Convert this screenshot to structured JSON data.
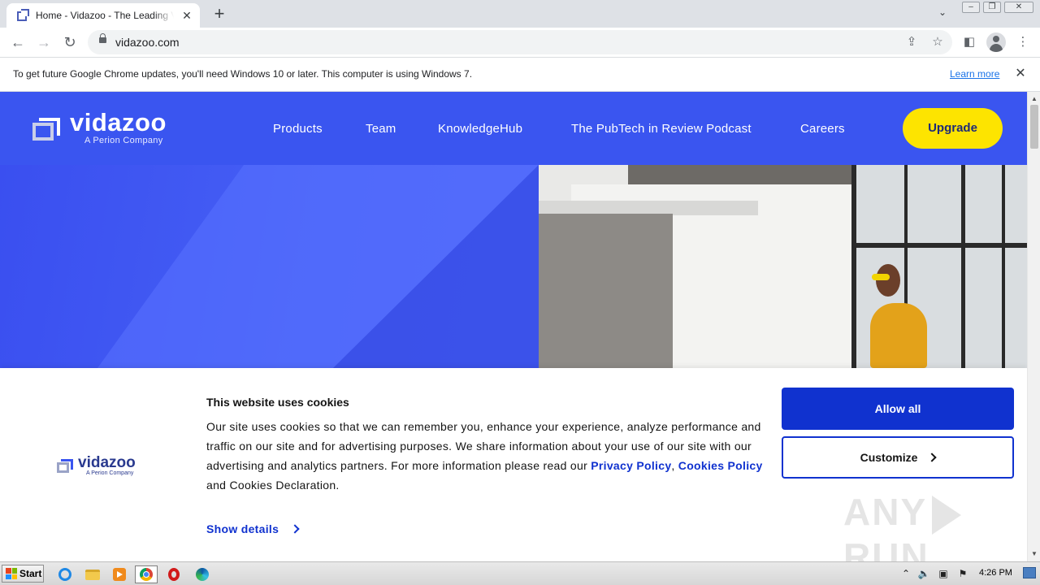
{
  "browser": {
    "tab": {
      "title": "Home - Vidazoo - The Leading Video"
    },
    "address": {
      "url": "vidazoo.com"
    },
    "infobar": {
      "message": "To get future Google Chrome updates, you'll need Windows 10 or later. This computer is using Windows 7.",
      "learn_more": "Learn more"
    }
  },
  "site": {
    "logo": {
      "word": "vidazoo",
      "sub": "A Perion Company"
    },
    "nav": [
      "Products",
      "Team",
      "KnowledgeHub",
      "The PubTech in Review Podcast",
      "Careers"
    ],
    "upgrade_label": "Upgrade",
    "colors": {
      "brand_blue": "#3a55f0",
      "upgrade_yellow": "#fde400",
      "cookie_blue": "#1032cf"
    }
  },
  "cookie": {
    "logo_word": "vidazoo",
    "logo_sub": "A Perion Company",
    "title": "This website uses cookies",
    "body_1": "Our site uses cookies so that we can remember you, enhance your experience, analyze performance and traffic on our site and for advertising purposes. We share information about your use of our site with our advertising and analytics partners. For more information please read our ",
    "privacy_link": "Privacy Policy",
    "sep": ", ",
    "cookies_link": "Cookies Policy",
    "body_2": " and Cookies Declaration.",
    "show_details": "Show details",
    "allow_all": "Allow all",
    "customize": "Customize"
  },
  "watermark": {
    "left": "ANY",
    "right": "RUN"
  },
  "taskbar": {
    "start_label": "Start",
    "clock": "4:26 PM"
  }
}
